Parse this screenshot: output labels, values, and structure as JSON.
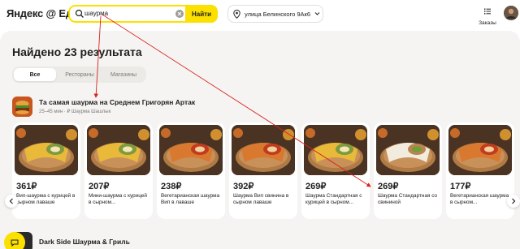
{
  "header": {
    "logo": "Яндекс @ Еда",
    "search": {
      "value": "шаурма",
      "button": "Найти"
    },
    "address": "улица Белинского 9Ак6",
    "orders_label": "Заказы"
  },
  "main": {
    "title": "Найдено 23 результата",
    "tabs": [
      {
        "label": "Все",
        "active": true
      },
      {
        "label": "Рестораны",
        "active": false
      },
      {
        "label": "Магазины",
        "active": false
      }
    ],
    "restaurant": {
      "name": "Та самая шаурма на Среднем Григорян Артак",
      "meta": "25–45 мин  ·  ₽  Шаурма  Шашлык"
    },
    "products": [
      {
        "price": "361₽",
        "name": "Вип-шаурма с курицей в сырном лаваше",
        "fill": "yellow"
      },
      {
        "price": "207₽",
        "name": "Мини-шаурма с курицей в сырном...",
        "fill": "yellow"
      },
      {
        "price": "238₽",
        "name": "Вегетарианская шаурма Вип в лаваше",
        "fill": "red"
      },
      {
        "price": "392₽",
        "name": "Шаурма Вип свинина в сырном лаваше",
        "fill": "red"
      },
      {
        "price": "269₽",
        "name": "Шаурма Стандартная с курицей в сырном...",
        "fill": "yellow"
      },
      {
        "price": "269₽",
        "name": "Шаурма Стандартная со свининой",
        "fill": "white"
      },
      {
        "price": "177₽",
        "name": "Вегетарианская шаурма в сырном...",
        "fill": "red"
      }
    ],
    "restaurant2": {
      "name": "Dark Side Шаурма & Гриль"
    }
  },
  "colors": {
    "accent": "#fce000",
    "annotation": "#d9201c"
  }
}
